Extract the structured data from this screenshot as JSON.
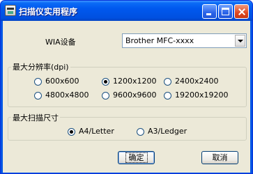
{
  "window": {
    "title": "扫描仪实用程序"
  },
  "device": {
    "label": "WIA设备",
    "selected": "Brother MFC-xxxx"
  },
  "resolution": {
    "group_title": "最大分辨率(dpi)",
    "options": [
      "600x600",
      "1200x1200",
      "2400x2400",
      "4800x4800",
      "9600x9600",
      "19200x19200"
    ],
    "selected": "1200x1200"
  },
  "scan_size": {
    "group_title": "最大扫描尺寸",
    "options": [
      "A4/Letter",
      "A3/Ledger"
    ],
    "selected": "A4/Letter"
  },
  "buttons": {
    "ok": "确定",
    "cancel": "取消"
  }
}
